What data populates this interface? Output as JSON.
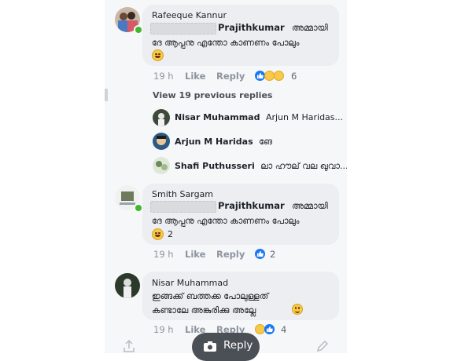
{
  "comments": [
    {
      "author": "Rafeeque Kannur",
      "mention": "Prajithkumar",
      "line1": "അമ്മായി",
      "line2": "ദേ ആപ്പനു എന്തോ കാണണം പോലും",
      "time": "19 h",
      "like_label": "Like",
      "reply_label": "Reply",
      "reaction_count": "6"
    },
    {
      "author": "Smith Sargam",
      "mention": "Prajithkumar",
      "line1": "അമ്മായി",
      "line2": "ദേ ആപ്പനു എന്തോ കാണണം പോലും",
      "emoji_count": "2",
      "time": "19 h",
      "like_label": "Like",
      "reply_label": "Reply",
      "reaction_count": "2"
    },
    {
      "author": "Nisar Muhammad",
      "line1": "ഇങ്ങക്ക് ബത്തക്ക പോലുള്ളത്",
      "line2": "കണ്ടാലേ അങ്കുരിക്കു അല്ലേ",
      "time": "19 h",
      "like_label": "Like",
      "reply_label": "Reply",
      "reaction_count": "4"
    }
  ],
  "replies_section": {
    "view_previous": "View 19 previous replies",
    "replies": [
      {
        "author": "Nisar Muhammad",
        "text": "Arjun M Haridas..."
      },
      {
        "author": "Arjun M Haridas",
        "text": "ങേ"
      },
      {
        "author": "Shafi Puthusseri",
        "text": "ലാ ഹൗല് വല ഖുവാ..."
      }
    ]
  },
  "composer": {
    "reply_button_label": "Reply"
  },
  "icons": {
    "like": "thumbs-up-icon",
    "haha": "laughing-face-icon",
    "wow": "surprised-face-icon",
    "camera": "camera-icon",
    "share": "share-icon",
    "edit": "pencil-icon"
  },
  "colors": {
    "like_blue": "#1877f2",
    "online_green": "#42b72a",
    "bubble_grey": "#eceef1"
  }
}
